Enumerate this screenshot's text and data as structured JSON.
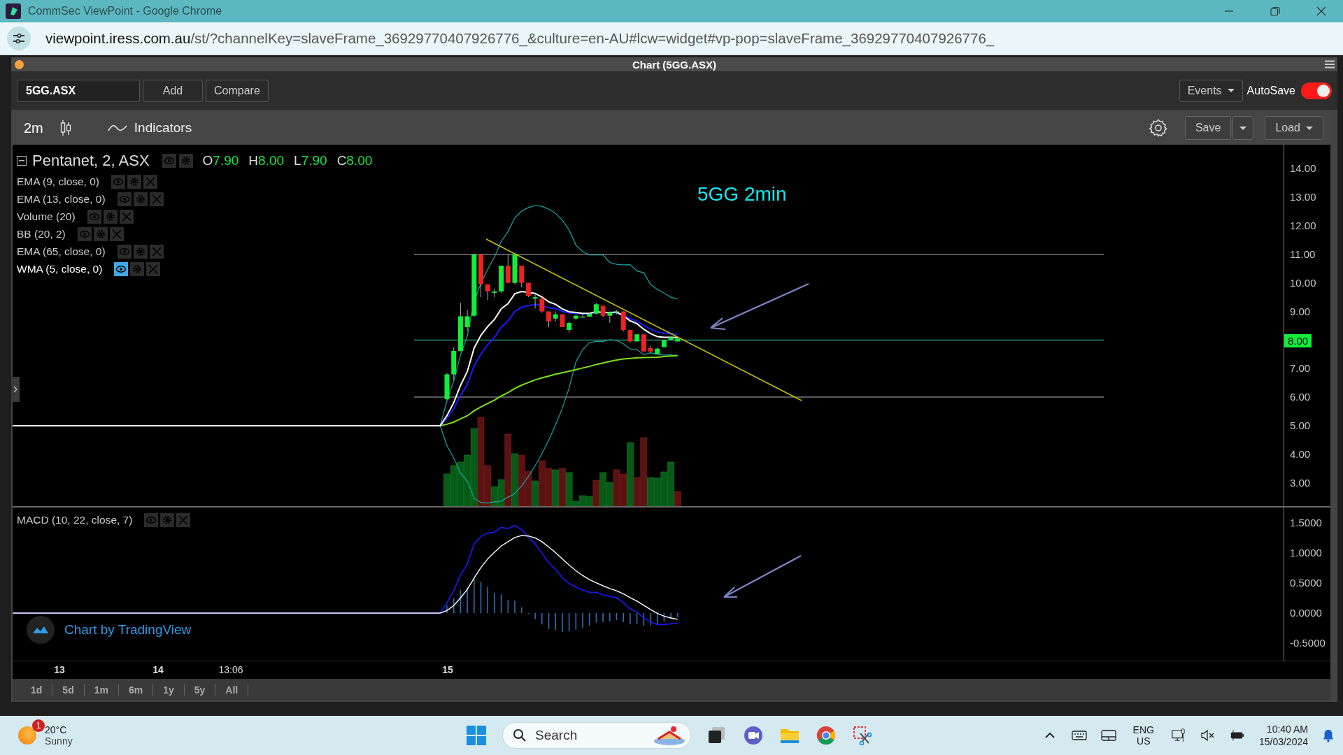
{
  "browser": {
    "title": "CommSec ViewPoint - Google Chrome",
    "url_domain": "viewpoint.iress.com.au",
    "url_path": "/st/?channelKey=slaveFrame_36929770407926776_&culture=en-AU#lcw=widget#vp-pop=slaveFrame_36929770407926776_"
  },
  "panel": {
    "title": "Chart (5GG.ASX)"
  },
  "toolbar": {
    "symbol": "5GG.ASX",
    "buttons": [
      "Add",
      "Compare"
    ],
    "events": "Events",
    "autosave": {
      "label": "AutoSave",
      "on": true
    }
  },
  "chart_toolbar": {
    "interval": "2m",
    "indicators": "Indicators",
    "save": "Save",
    "load": "Load"
  },
  "legend": {
    "title": "Pentanet, 2, ASX",
    "ohlc": [
      {
        "label": "O",
        "value": "7.90"
      },
      {
        "label": "H",
        "value": "8.00"
      },
      {
        "label": "L",
        "value": "7.90"
      },
      {
        "label": "C",
        "value": "8.00"
      }
    ]
  },
  "indicators": [
    {
      "name": "EMA (9, close, 0)",
      "highlighted": false
    },
    {
      "name": "EMA (13, close, 0)",
      "highlighted": false
    },
    {
      "name": "Volume (20)",
      "highlighted": false
    },
    {
      "name": "BB (20, 2)",
      "highlighted": false
    },
    {
      "name": "EMA (65, close, 0)",
      "highlighted": false
    },
    {
      "name": "WMA (5, close, 0)",
      "highlighted": true
    }
  ],
  "annotation": "5GG 2min",
  "price_axis": {
    "ticks": [
      "14.00",
      "13.00",
      "12.00",
      "11.00",
      "10.00",
      "9.00",
      "7.00",
      "6.00",
      "5.00",
      "4.00",
      "3.00"
    ],
    "last_price": "8.00"
  },
  "macd": {
    "name": "MACD (10, 22, close, 7)",
    "ticks": [
      "1.5000",
      "1.0000",
      "0.5000",
      "0.0000",
      "-0.5000"
    ]
  },
  "branding": "Chart by TradingView",
  "time_axis": [
    "13",
    "14",
    "13:06",
    "15"
  ],
  "ranges": [
    "1d",
    "5d",
    "1m",
    "6m",
    "1y",
    "5y",
    "All"
  ],
  "taskbar": {
    "weather": {
      "badge": "1",
      "temp": "20°C",
      "condition": "Sunny"
    },
    "search": "Search",
    "lang": [
      "ENG",
      "US"
    ],
    "time": "10:40 AM",
    "date": "15/03/2024"
  }
}
